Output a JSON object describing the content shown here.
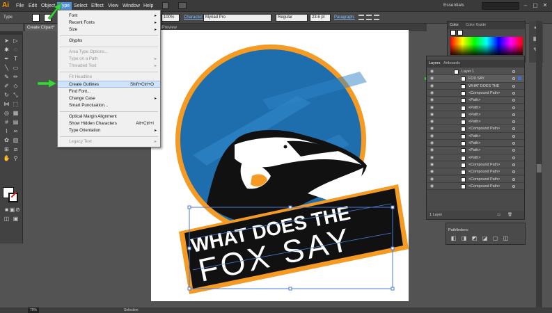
{
  "menubar": {
    "logo": "Ai",
    "items": [
      "File",
      "Edit",
      "Object",
      "Type",
      "Select",
      "Effect",
      "View",
      "Window",
      "Help"
    ],
    "workspace": "Essentials",
    "window_controls": [
      "–",
      "▢",
      "✕"
    ]
  },
  "control": {
    "mode_label": "Type",
    "opacity": "100%",
    "character_label": "Character:",
    "font_family": "Myriad Pro",
    "font_style": "Regular",
    "font_size": "23.6 pt",
    "paragraph_label": "Paragraph:"
  },
  "document": {
    "tab_label": "Create Clipart*",
    "tab_tail": "RGB/Preview"
  },
  "type_menu": {
    "items": [
      {
        "label": "Font",
        "submenu": true,
        "disabled": false
      },
      {
        "label": "Recent Fonts",
        "submenu": true,
        "disabled": false
      },
      {
        "label": "Size",
        "submenu": true,
        "disabled": false
      },
      {
        "separator": true
      },
      {
        "label": "Glyphs",
        "disabled": false
      },
      {
        "separator": true
      },
      {
        "label": "Area Type Options...",
        "disabled": true
      },
      {
        "label": "Type on a Path",
        "submenu": true,
        "disabled": true
      },
      {
        "label": "Threaded Text",
        "submenu": true,
        "disabled": true
      },
      {
        "separator": true
      },
      {
        "label": "Fit Headline",
        "disabled": true
      },
      {
        "label": "Create Outlines",
        "shortcut": "Shift+Ctrl+O",
        "disabled": false,
        "highlighted": true
      },
      {
        "label": "Find Font...",
        "disabled": false
      },
      {
        "label": "Change Case",
        "submenu": true,
        "disabled": false
      },
      {
        "label": "Smart Punctuation...",
        "disabled": false
      },
      {
        "separator": true
      },
      {
        "label": "Optical Margin Alignment",
        "disabled": false
      },
      {
        "label": "Show Hidden Characters",
        "shortcut": "Alt+Ctrl+I",
        "disabled": false
      },
      {
        "label": "Type Orientation",
        "submenu": true,
        "disabled": false
      },
      {
        "separator": true
      },
      {
        "label": "Legacy Text",
        "submenu": true,
        "disabled": true
      }
    ]
  },
  "artwork": {
    "line1": "WHAT DOES THE",
    "line2": "FOX SAY",
    "colors": {
      "blue": "#1e6eae",
      "orange": "#f59a23",
      "black": "#111111",
      "white": "#ffffff"
    }
  },
  "color_panel": {
    "tabs": [
      "Color",
      "Color Guide"
    ]
  },
  "layers_panel": {
    "tabs": [
      "Layers",
      "Artboards"
    ],
    "rows": [
      {
        "name": "Layer 1"
      },
      {
        "name": "FOX SAY"
      },
      {
        "name": "WHAT DOES THE"
      },
      {
        "name": "<Compound Path>"
      },
      {
        "name": "<Path>"
      },
      {
        "name": "<Path>"
      },
      {
        "name": "<Path>"
      },
      {
        "name": "<Path>"
      },
      {
        "name": "<Compound Path>"
      },
      {
        "name": "<Path>"
      },
      {
        "name": "<Path>"
      },
      {
        "name": "<Path>"
      },
      {
        "name": "<Path>"
      },
      {
        "name": "<Compound Path>"
      },
      {
        "name": "<Compound Path>"
      },
      {
        "name": "<Compound Path>"
      },
      {
        "name": "<Compound Path>"
      }
    ],
    "footer": "1 Layer"
  },
  "pathfinder": {
    "label": "Pathfinders:"
  },
  "status": {
    "zoom": "70%",
    "tool": "Selection"
  }
}
